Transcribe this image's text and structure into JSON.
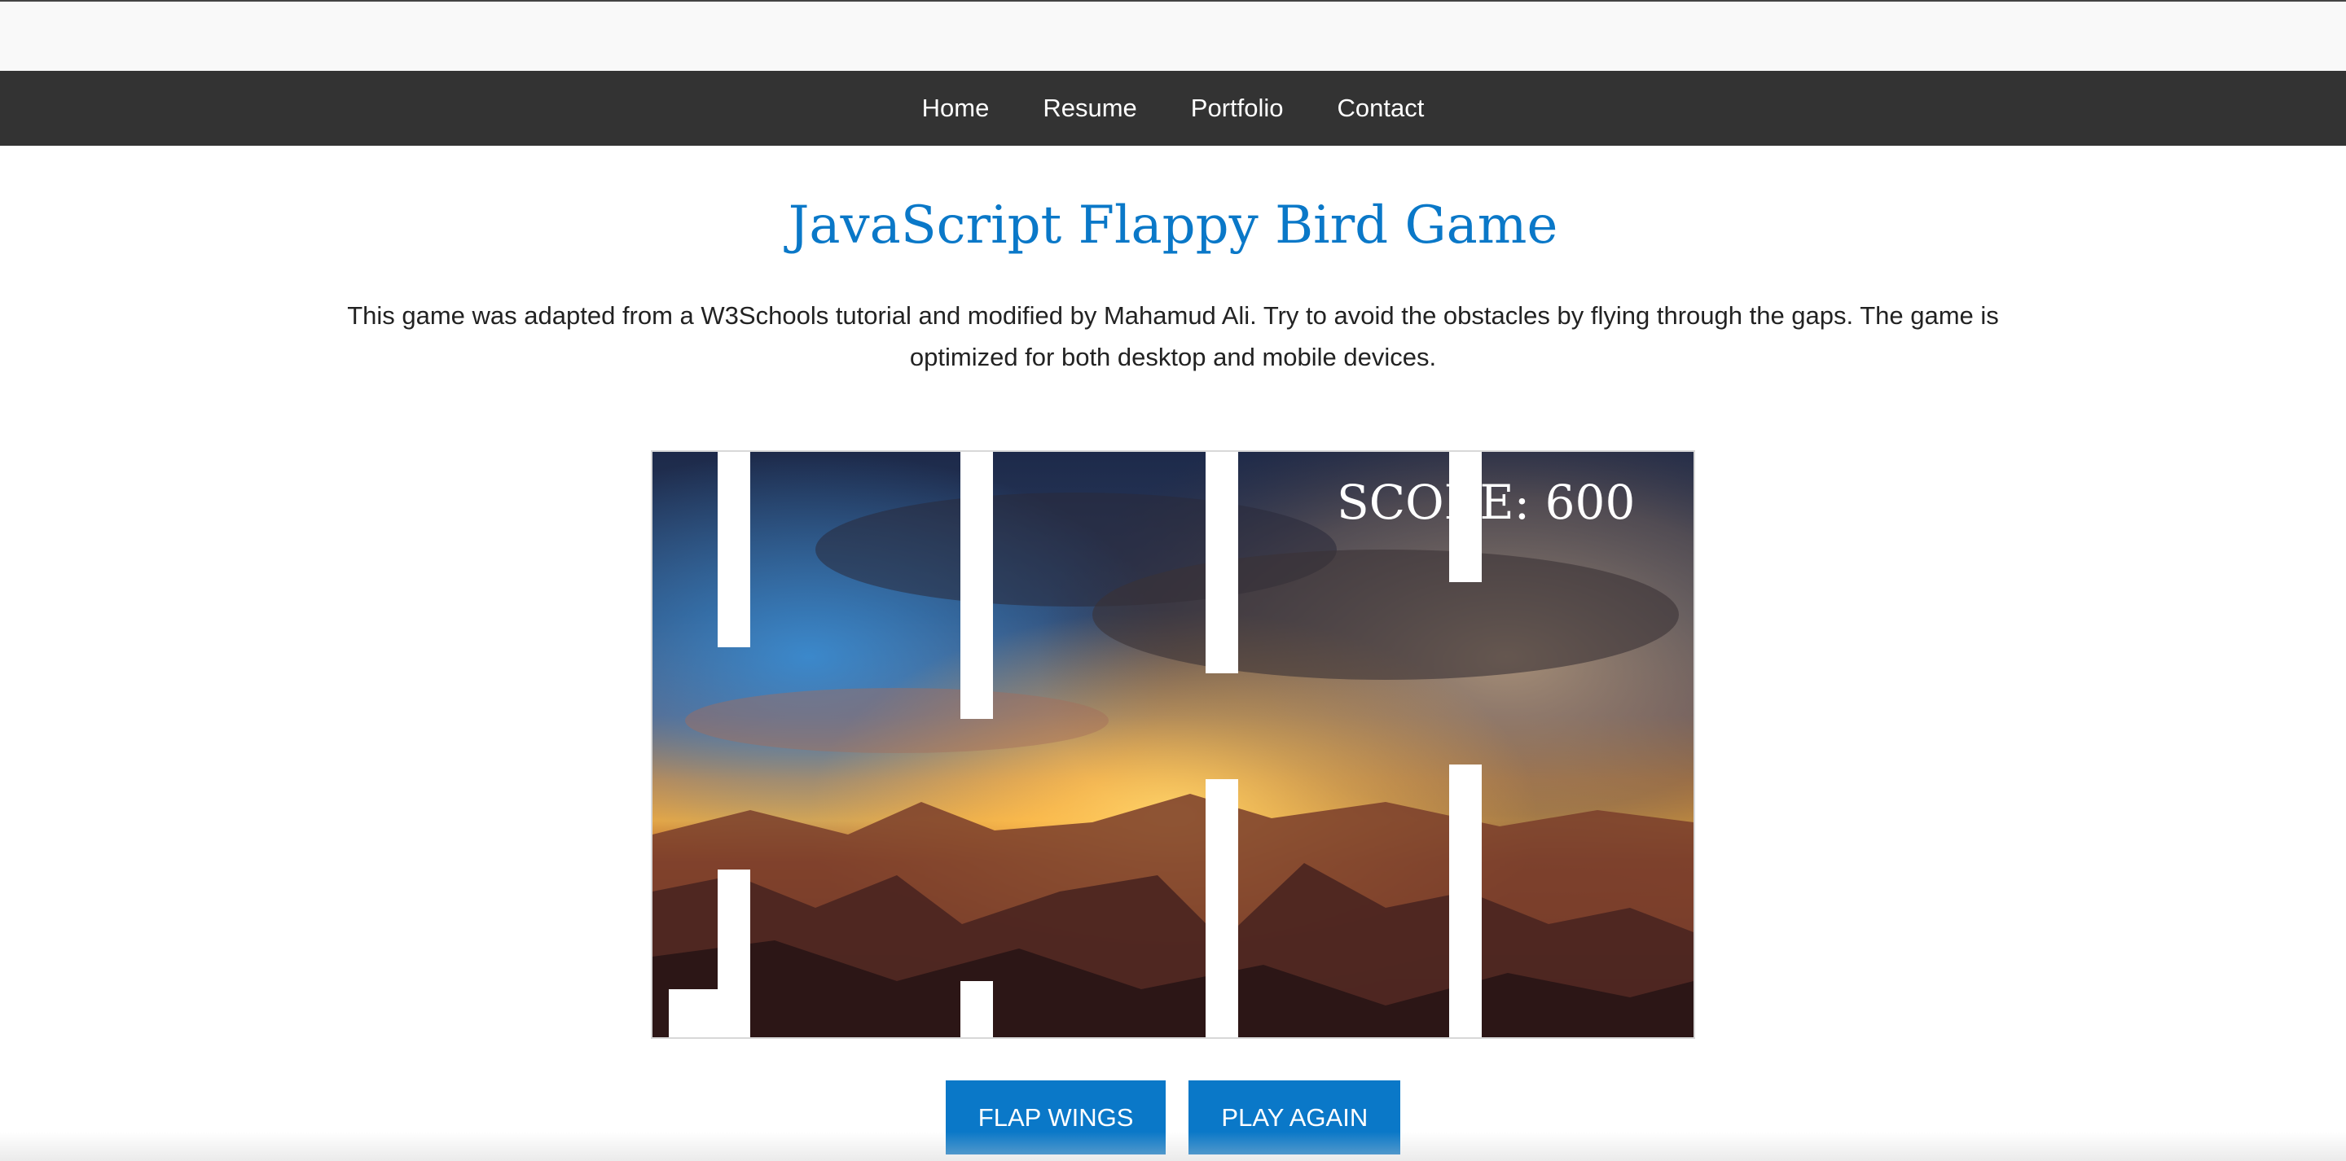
{
  "nav": {
    "items": [
      {
        "label": "Home"
      },
      {
        "label": "Resume"
      },
      {
        "label": "Portfolio"
      },
      {
        "label": "Contact"
      }
    ]
  },
  "page": {
    "title": "JavaScript Flappy Bird Game",
    "description": "This game was adapted from a W3Schools tutorial and modified by Mahamud Ali. Try to avoid the obstacles by flying through the gaps. The game is optimized for both desktop and mobile devices."
  },
  "game": {
    "score_text": "SCORE: 600",
    "obstacle_color": "#ffffff",
    "background": "stormy sunset sky over mountains"
  },
  "controls": {
    "flap_label": "FLAP WINGS",
    "play_again_label": "PLAY AGAIN"
  },
  "colors": {
    "accent": "#0a78c8",
    "nav_bg": "#333333"
  }
}
